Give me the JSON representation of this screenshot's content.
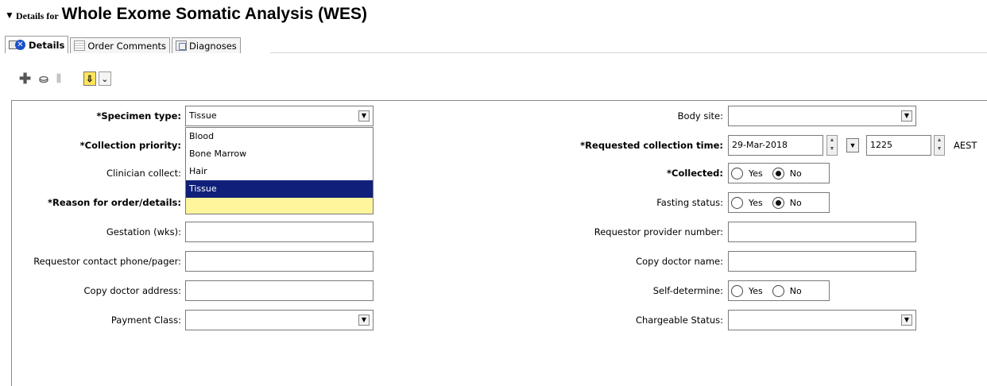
{
  "header": {
    "prefix": "Details for",
    "title": "Whole Exome Somatic Analysis (WES)"
  },
  "tabs": [
    {
      "label": "Details",
      "active": true
    },
    {
      "label": "Order Comments",
      "active": false
    },
    {
      "label": "Diagnoses",
      "active": false
    }
  ],
  "toolbar": {
    "icons": [
      "add-icon",
      "copy-icon",
      "chart-icon",
      "move-down-icon",
      "expand-icon"
    ]
  },
  "form": {
    "specimen_type": {
      "label": "*Specimen type:",
      "value": "Tissue",
      "options": [
        "Blood",
        "Bone Marrow",
        "Hair",
        "Tissue"
      ],
      "selected": "Tissue"
    },
    "collection_priority": {
      "label": "*Collection priority:",
      "value": ""
    },
    "clinician_collect": {
      "label": "Clinician collect:",
      "value": ""
    },
    "reason": {
      "label": "*Reason for order/details:",
      "value": ""
    },
    "gestation": {
      "label": "Gestation (wks):",
      "value": ""
    },
    "requestor_phone": {
      "label": "Requestor contact phone/pager:",
      "value": ""
    },
    "copy_doctor_address": {
      "label": "Copy doctor address:",
      "value": ""
    },
    "payment_class": {
      "label": "Payment Class:",
      "value": ""
    },
    "body_site": {
      "label": "Body site:",
      "value": ""
    },
    "requested_collection_time": {
      "label": "*Requested collection time:",
      "date": "29-Mar-2018",
      "time": "1225",
      "tz": "AEST"
    },
    "collected": {
      "label": "*Collected:",
      "options": [
        "Yes",
        "No"
      ],
      "selected": "No"
    },
    "fasting_status": {
      "label": "Fasting status:",
      "options": [
        "Yes",
        "No"
      ],
      "selected": "No"
    },
    "requestor_provider_number": {
      "label": "Requestor provider number:",
      "value": ""
    },
    "copy_doctor_name": {
      "label": "Copy doctor name:",
      "value": ""
    },
    "self_determine": {
      "label": "Self-determine:",
      "options": [
        "Yes",
        "No"
      ],
      "selected": ""
    },
    "chargeable_status": {
      "label": "Chargeable Status:",
      "value": ""
    }
  },
  "colors": {
    "required_field": "#fff59c",
    "selection": "#10207a"
  }
}
